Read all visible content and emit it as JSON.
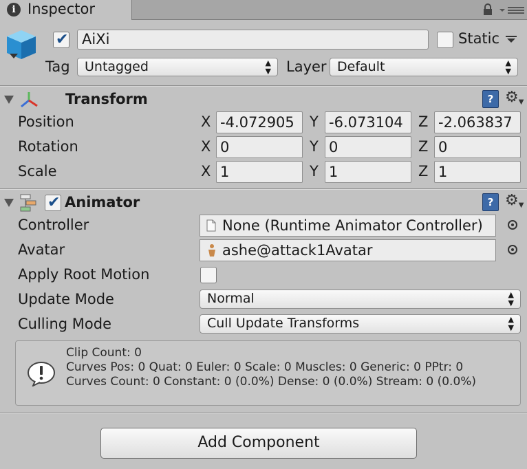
{
  "tab": {
    "title": "Inspector",
    "info_icon_glyph": "i"
  },
  "header": {
    "object_name": "AiXi",
    "active": true,
    "static_label": "Static",
    "static": false,
    "tag_label": "Tag",
    "tag_value": "Untagged",
    "layer_label": "Layer",
    "layer_value": "Default"
  },
  "transform": {
    "title": "Transform",
    "rows": [
      {
        "label": "Position",
        "x": "-4.072905",
        "y": "-6.073104",
        "z": "-2.063837"
      },
      {
        "label": "Rotation",
        "x": "0",
        "y": "0",
        "z": "0"
      },
      {
        "label": "Scale",
        "x": "1",
        "y": "1",
        "z": "1"
      }
    ],
    "axis_x": "X",
    "axis_y": "Y",
    "axis_z": "Z"
  },
  "animator": {
    "title": "Animator",
    "enabled": true,
    "controller_label": "Controller",
    "controller_value": "None (Runtime Animator Controller)",
    "avatar_label": "Avatar",
    "avatar_value": "ashe@attack1Avatar",
    "apply_root_motion_label": "Apply Root Motion",
    "apply_root_motion": false,
    "update_mode_label": "Update Mode",
    "update_mode_value": "Normal",
    "culling_mode_label": "Culling Mode",
    "culling_mode_value": "Cull Update Transforms",
    "info": {
      "line1": "Clip Count: 0",
      "line2": "Curves Pos: 0 Quat: 0 Euler: 0 Scale: 0 Muscles: 0 Generic: 0 PPtr: 0",
      "line3": "Curves Count: 0 Constant: 0 (0.0%) Dense: 0 (0.0%) Stream: 0 (0.0%)"
    }
  },
  "add_component_label": "Add Component",
  "help_glyph": "?",
  "colors": {
    "panel_bg": "#c2c2c2",
    "accent_blue": "#3d6aa8",
    "check_blue": "#1b4f8a"
  }
}
